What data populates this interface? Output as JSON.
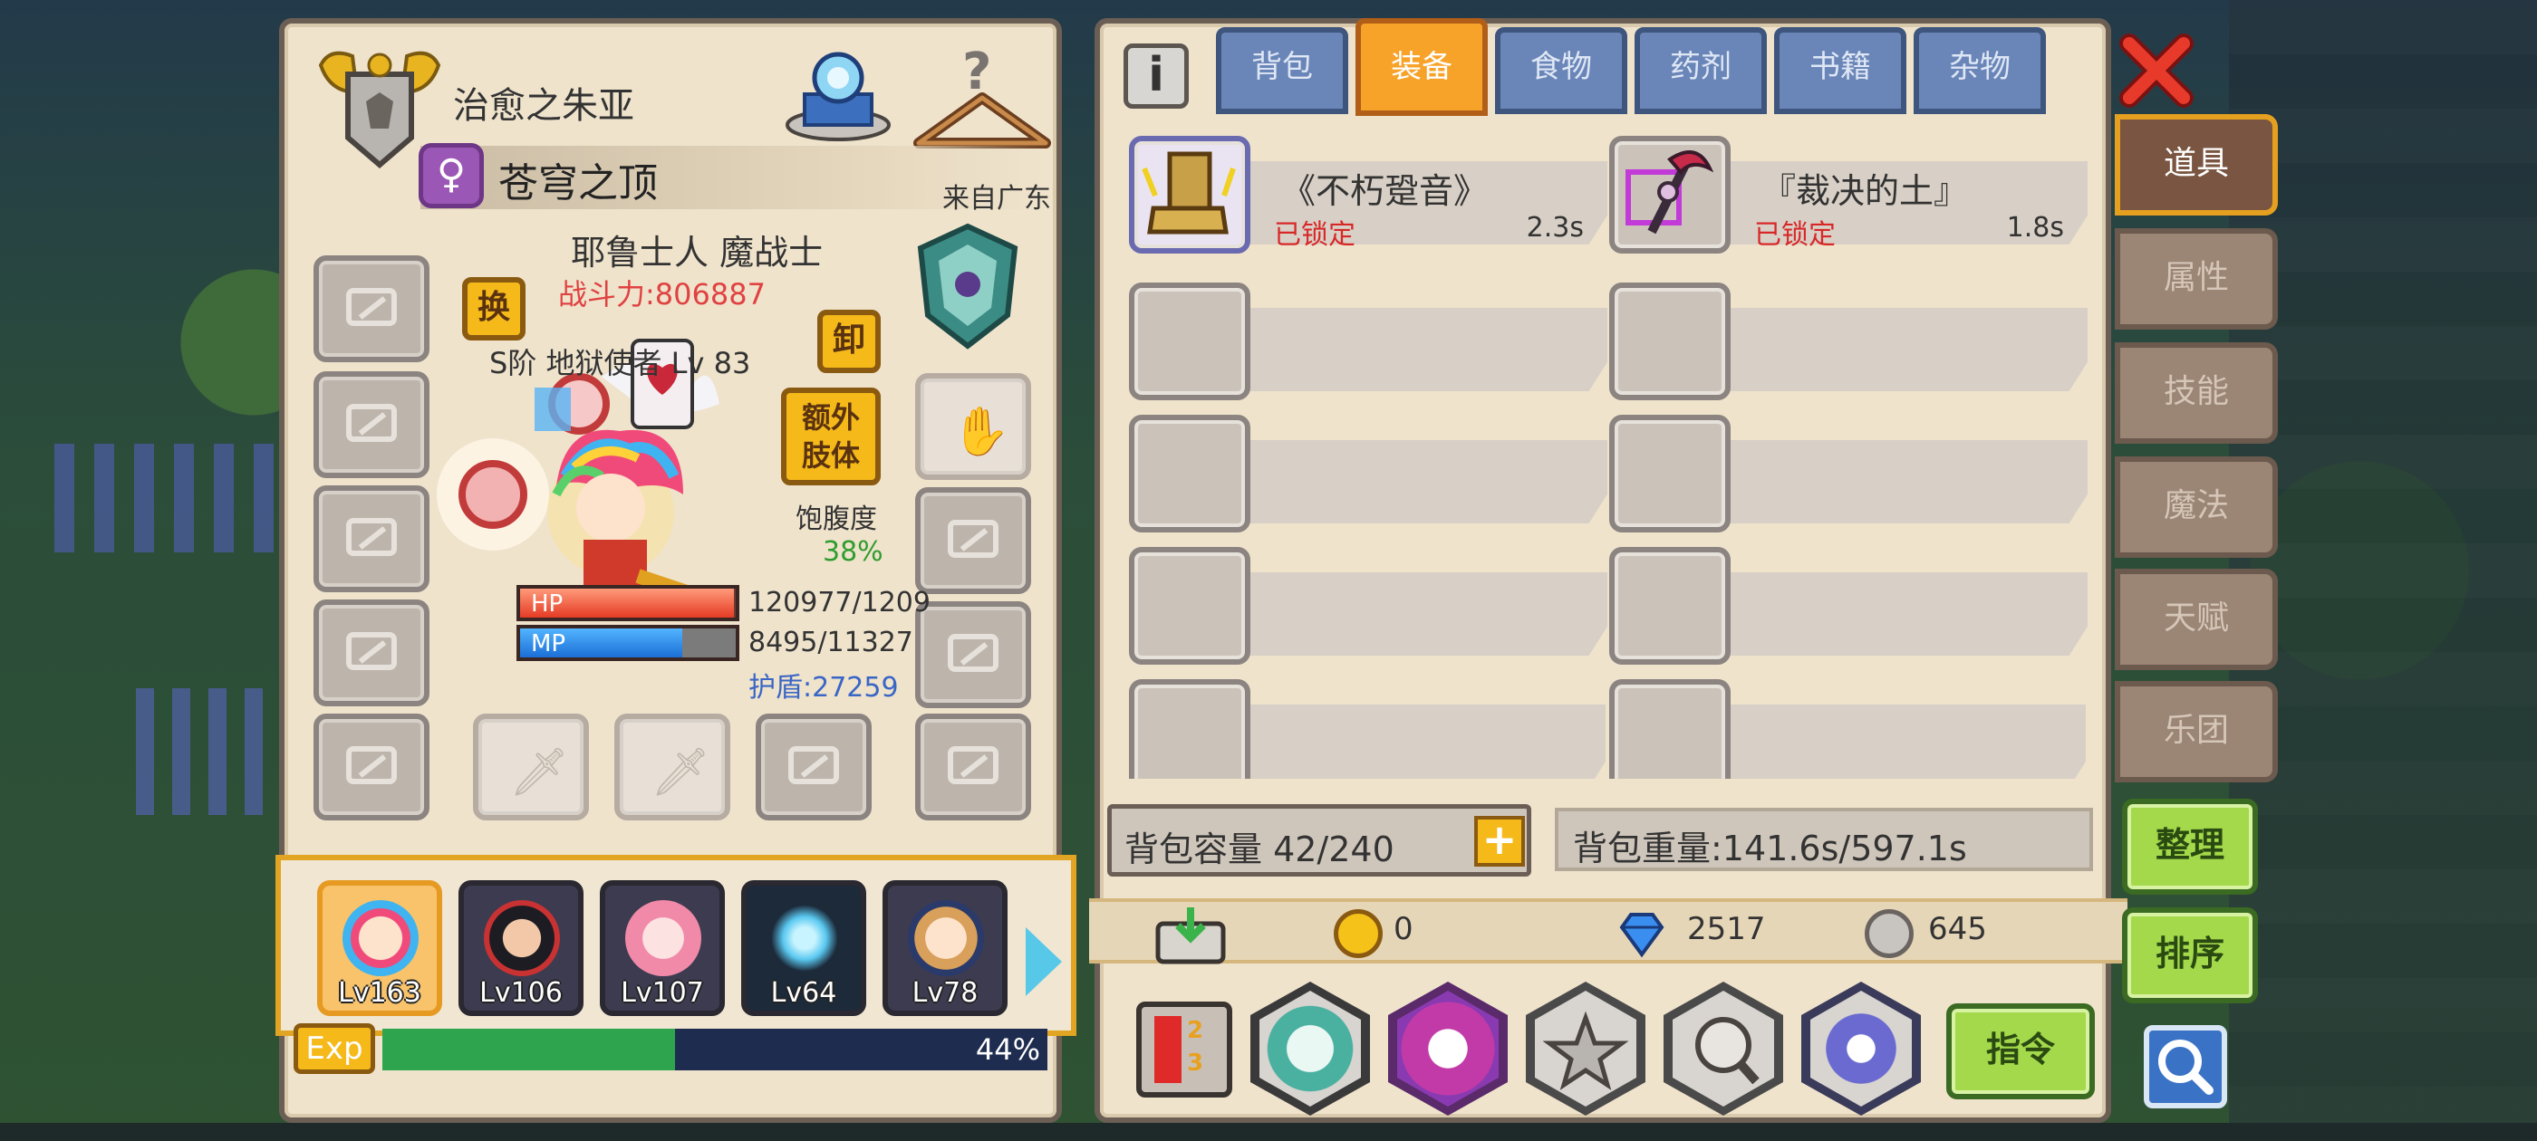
{
  "character": {
    "title": "治愈之朱亚",
    "guild": "苍穹之顶",
    "origin": "来自广东",
    "race_class": "耶鲁士人 魔战士",
    "combat_power": "战斗力:806887",
    "pet_line": "S阶 地狱使者 Lv 83",
    "swap_label": "换",
    "unequip_label": "卸",
    "extra_limb_label": "额外肢体",
    "satiety_label": "饱腹度",
    "satiety_value": "38%",
    "hp_label": "HP",
    "hp_value": "120977/1209",
    "hp_fraction": 0.99,
    "mp_label": "MP",
    "mp_value": "8495/11327",
    "mp_fraction": 0.75,
    "shield": "护盾:27259"
  },
  "team": [
    {
      "level": "Lv163",
      "active": true
    },
    {
      "level": "Lv106",
      "active": false
    },
    {
      "level": "Lv107",
      "active": false
    },
    {
      "level": "Lv64",
      "active": false
    },
    {
      "level": "Lv78",
      "active": false
    }
  ],
  "exp": {
    "label": "Exp",
    "percent": "44%",
    "fraction": 0.44
  },
  "tabs": [
    "背包",
    "装备",
    "食物",
    "药剂",
    "书籍",
    "杂物"
  ],
  "active_tab": "装备",
  "items": [
    {
      "name": "《不朽跫音》",
      "status": "已锁定",
      "weight": "2.3s"
    },
    {
      "name": "『裁决的土』",
      "status": "已锁定",
      "weight": "1.8s"
    }
  ],
  "bag": {
    "capacity": "背包容量 42/240",
    "weight": "背包重量:141.6s/597.1s"
  },
  "currency": {
    "gold": "0",
    "diamond": "2517",
    "silver": "645"
  },
  "buttons": {
    "command": "指令",
    "sort_tidy": "整理",
    "sort_order": "排序"
  },
  "side_tabs": [
    "道具",
    "属性",
    "技能",
    "魔法",
    "天赋",
    "乐团"
  ],
  "colors": {
    "accent": "#f7a32a",
    "panel": "#efe3cc",
    "lock_red": "#d72828",
    "exp_green": "#2ea44f"
  }
}
